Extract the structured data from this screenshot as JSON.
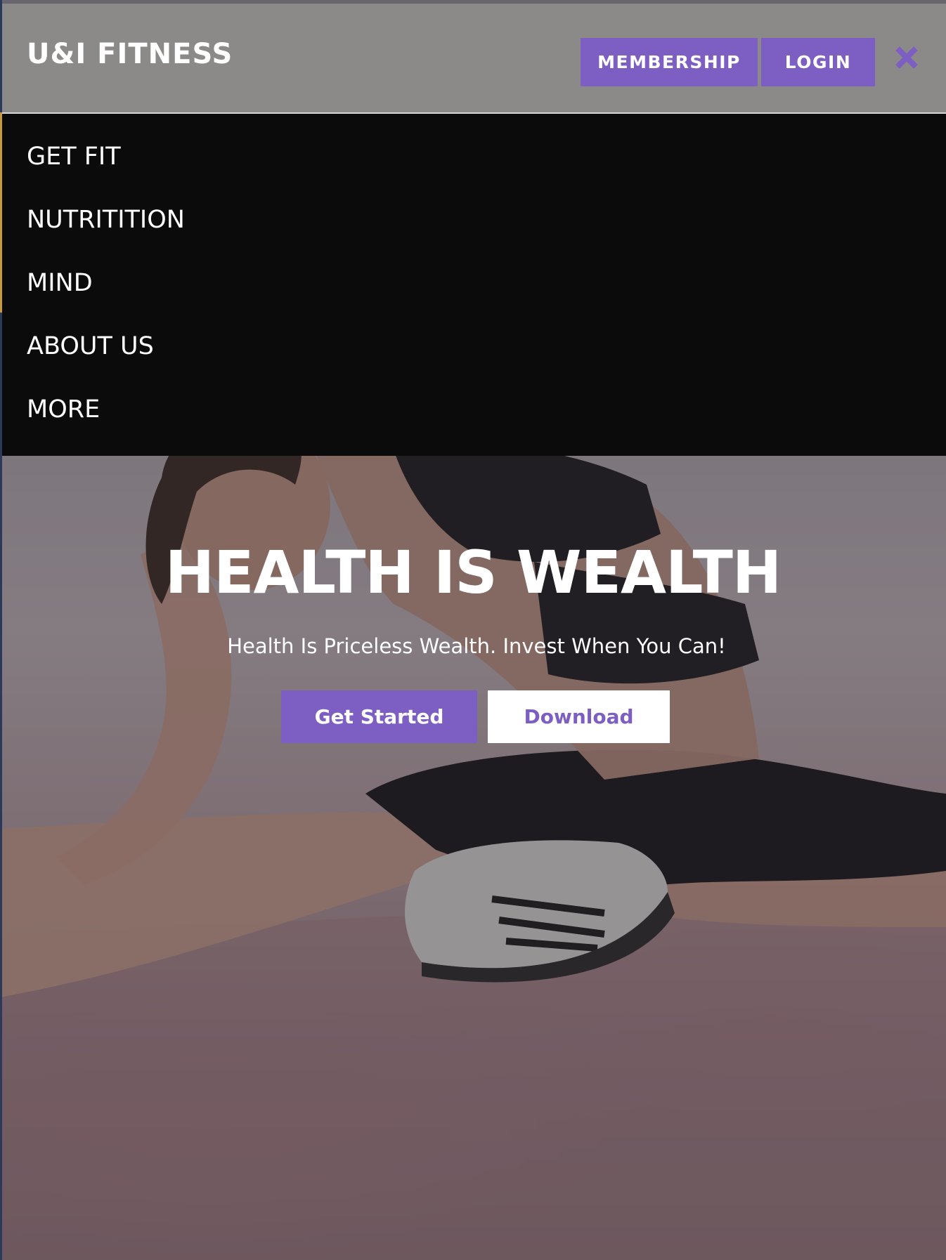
{
  "header": {
    "brand": "U&I FITNESS",
    "membership_label": "MEMBERSHIP",
    "login_label": "LOGIN",
    "close_icon": "close-icon"
  },
  "nav": {
    "items": [
      {
        "label": "GET FIT"
      },
      {
        "label": "NUTRITITION"
      },
      {
        "label": "MIND"
      },
      {
        "label": "ABOUT US"
      },
      {
        "label": "MORE"
      }
    ]
  },
  "hero": {
    "title": "HEALTH IS WEALTH",
    "subtitle": "Health Is Priceless Wealth. Invest When You Can!",
    "primary_button": "Get Started",
    "secondary_button": "Download"
  },
  "colors": {
    "accent": "#7d5ec2",
    "header_bg": "#8b8a89",
    "menu_bg": "#0b0b0b",
    "text_light": "#ffffff"
  }
}
